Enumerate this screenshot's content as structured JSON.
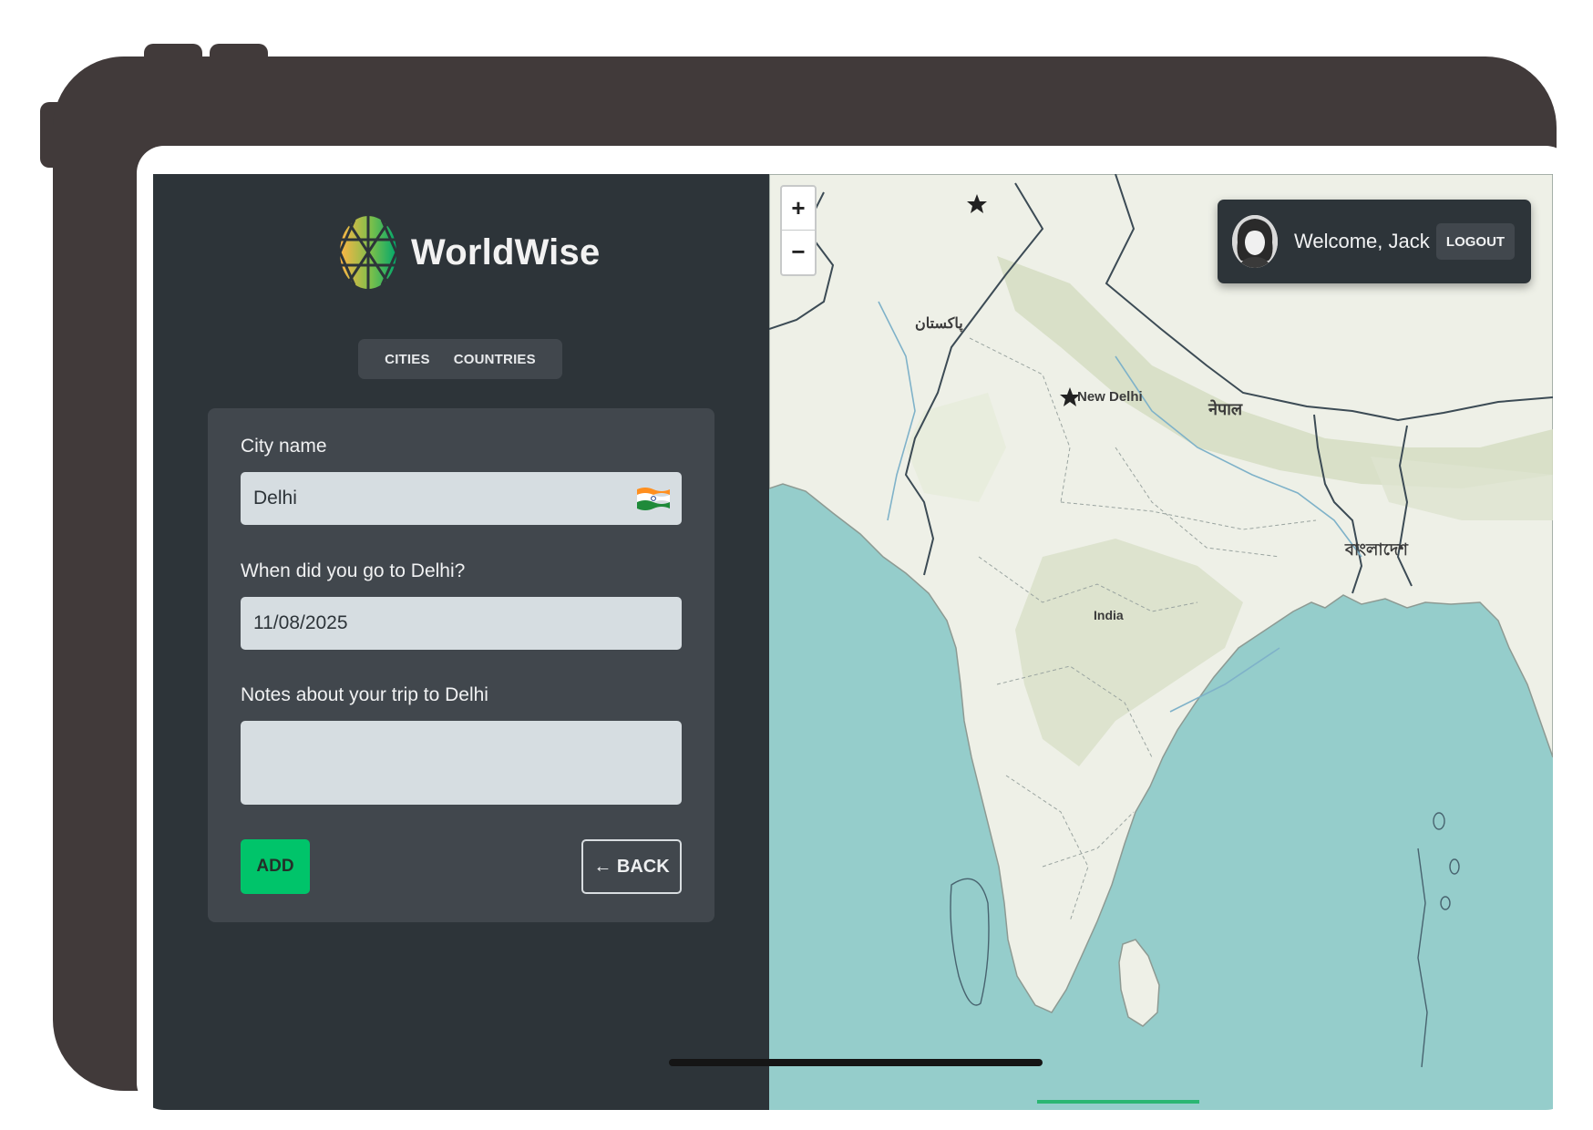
{
  "app": {
    "name": "WorldWise"
  },
  "tabs": [
    {
      "label": "CITIES"
    },
    {
      "label": "COUNTRIES"
    }
  ],
  "form": {
    "city_label": "City name",
    "city_value": "Delhi",
    "city_flag": "india-flag",
    "date_label": "When did you go to Delhi?",
    "date_value": "11/08/2025",
    "notes_label": "Notes about your trip to Delhi",
    "notes_value": "",
    "add_label": "ADD",
    "back_label": "← BACK"
  },
  "map": {
    "zoom_in": "+",
    "zoom_out": "−",
    "labels": {
      "pakistan": "پاکستان",
      "new_delhi": "New Delhi",
      "nepal": "नेपाल",
      "bangladesh": "বাংলাদেশ",
      "india": "India"
    }
  },
  "user": {
    "welcome": "Welcome, Jack",
    "logout_label": "LOGOUT"
  },
  "colors": {
    "sidebar_bg": "#2d3439",
    "panel_bg": "#41474d",
    "input_bg": "#d6dde1",
    "brand_green": "#00c46a",
    "sea": "#95cdcb",
    "frame": "#413a3a"
  }
}
